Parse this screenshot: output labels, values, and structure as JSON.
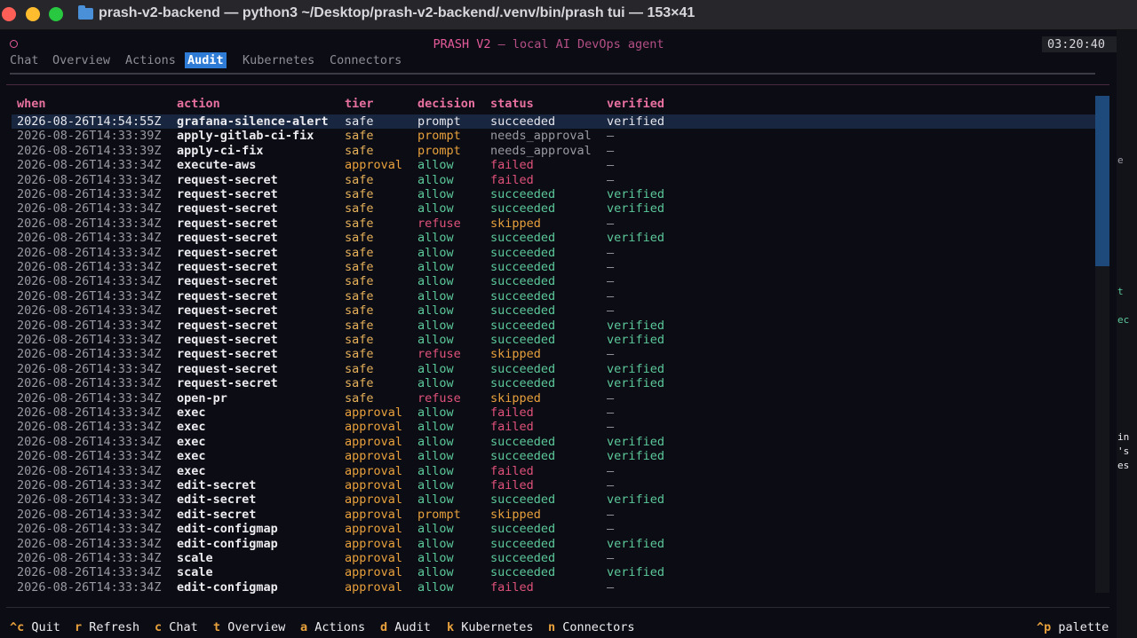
{
  "window": {
    "title": "prash-v2-backend — python3 ~/Desktop/prash-v2-backend/.venv/bin/prash tui — 153×41"
  },
  "app": {
    "title_main": "PRASH V2",
    "title_sub": " — local AI DevOps agent",
    "clock": "03:20:40"
  },
  "tabs": [
    {
      "label": "Chat",
      "active": false
    },
    {
      "label": "Overview",
      "active": false
    },
    {
      "label": "Actions",
      "active": false
    },
    {
      "label": "Audit",
      "active": true
    },
    {
      "label": "Kubernetes",
      "active": false
    },
    {
      "label": "Connectors",
      "active": false
    }
  ],
  "table": {
    "columns": [
      "when",
      "action",
      "tier",
      "decision",
      "status",
      "verified"
    ],
    "rows": [
      [
        "2026-08-26T14:54:55Z",
        "grafana-silence-alert",
        "safe",
        "prompt",
        "succeeded",
        "verified"
      ],
      [
        "2026-08-26T14:33:39Z",
        "apply-gitlab-ci-fix",
        "safe",
        "prompt",
        "needs_approval",
        "—"
      ],
      [
        "2026-08-26T14:33:39Z",
        "apply-ci-fix",
        "safe",
        "prompt",
        "needs_approval",
        "—"
      ],
      [
        "2026-08-26T14:33:34Z",
        "execute-aws",
        "approval",
        "allow",
        "failed",
        "—"
      ],
      [
        "2026-08-26T14:33:34Z",
        "request-secret",
        "safe",
        "allow",
        "failed",
        "—"
      ],
      [
        "2026-08-26T14:33:34Z",
        "request-secret",
        "safe",
        "allow",
        "succeeded",
        "verified"
      ],
      [
        "2026-08-26T14:33:34Z",
        "request-secret",
        "safe",
        "allow",
        "succeeded",
        "verified"
      ],
      [
        "2026-08-26T14:33:34Z",
        "request-secret",
        "safe",
        "refuse",
        "skipped",
        "—"
      ],
      [
        "2026-08-26T14:33:34Z",
        "request-secret",
        "safe",
        "allow",
        "succeeded",
        "verified"
      ],
      [
        "2026-08-26T14:33:34Z",
        "request-secret",
        "safe",
        "allow",
        "succeeded",
        "—"
      ],
      [
        "2026-08-26T14:33:34Z",
        "request-secret",
        "safe",
        "allow",
        "succeeded",
        "—"
      ],
      [
        "2026-08-26T14:33:34Z",
        "request-secret",
        "safe",
        "allow",
        "succeeded",
        "—"
      ],
      [
        "2026-08-26T14:33:34Z",
        "request-secret",
        "safe",
        "allow",
        "succeeded",
        "—"
      ],
      [
        "2026-08-26T14:33:34Z",
        "request-secret",
        "safe",
        "allow",
        "succeeded",
        "—"
      ],
      [
        "2026-08-26T14:33:34Z",
        "request-secret",
        "safe",
        "allow",
        "succeeded",
        "verified"
      ],
      [
        "2026-08-26T14:33:34Z",
        "request-secret",
        "safe",
        "allow",
        "succeeded",
        "verified"
      ],
      [
        "2026-08-26T14:33:34Z",
        "request-secret",
        "safe",
        "refuse",
        "skipped",
        "—"
      ],
      [
        "2026-08-26T14:33:34Z",
        "request-secret",
        "safe",
        "allow",
        "succeeded",
        "verified"
      ],
      [
        "2026-08-26T14:33:34Z",
        "request-secret",
        "safe",
        "allow",
        "succeeded",
        "verified"
      ],
      [
        "2026-08-26T14:33:34Z",
        "open-pr",
        "safe",
        "refuse",
        "skipped",
        "—"
      ],
      [
        "2026-08-26T14:33:34Z",
        "exec",
        "approval",
        "allow",
        "failed",
        "—"
      ],
      [
        "2026-08-26T14:33:34Z",
        "exec",
        "approval",
        "allow",
        "failed",
        "—"
      ],
      [
        "2026-08-26T14:33:34Z",
        "exec",
        "approval",
        "allow",
        "succeeded",
        "verified"
      ],
      [
        "2026-08-26T14:33:34Z",
        "exec",
        "approval",
        "allow",
        "succeeded",
        "verified"
      ],
      [
        "2026-08-26T14:33:34Z",
        "exec",
        "approval",
        "allow",
        "failed",
        "—"
      ],
      [
        "2026-08-26T14:33:34Z",
        "edit-secret",
        "approval",
        "allow",
        "failed",
        "—"
      ],
      [
        "2026-08-26T14:33:34Z",
        "edit-secret",
        "approval",
        "allow",
        "succeeded",
        "verified"
      ],
      [
        "2026-08-26T14:33:34Z",
        "edit-secret",
        "approval",
        "prompt",
        "skipped",
        "—"
      ],
      [
        "2026-08-26T14:33:34Z",
        "edit-configmap",
        "approval",
        "allow",
        "succeeded",
        "—"
      ],
      [
        "2026-08-26T14:33:34Z",
        "edit-configmap",
        "approval",
        "allow",
        "succeeded",
        "verified"
      ],
      [
        "2026-08-26T14:33:34Z",
        "scale",
        "approval",
        "allow",
        "succeeded",
        "—"
      ],
      [
        "2026-08-26T14:33:34Z",
        "scale",
        "approval",
        "allow",
        "succeeded",
        "verified"
      ],
      [
        "2026-08-26T14:33:34Z",
        "edit-configmap",
        "approval",
        "allow",
        "failed",
        "—"
      ]
    ]
  },
  "footer": [
    {
      "key": "^c",
      "label": "Quit"
    },
    {
      "key": "r",
      "label": "Refresh"
    },
    {
      "key": "c",
      "label": "Chat"
    },
    {
      "key": "t",
      "label": "Overview"
    },
    {
      "key": "a",
      "label": "Actions"
    },
    {
      "key": "d",
      "label": "Audit"
    },
    {
      "key": "k",
      "label": "Kubernetes"
    },
    {
      "key": "n",
      "label": "Connectors"
    }
  ],
  "footer_right": {
    "key": "^p",
    "label": "palette"
  },
  "side_strip": [
    "e",
    "t",
    "ec",
    "in",
    "'s",
    "es"
  ]
}
